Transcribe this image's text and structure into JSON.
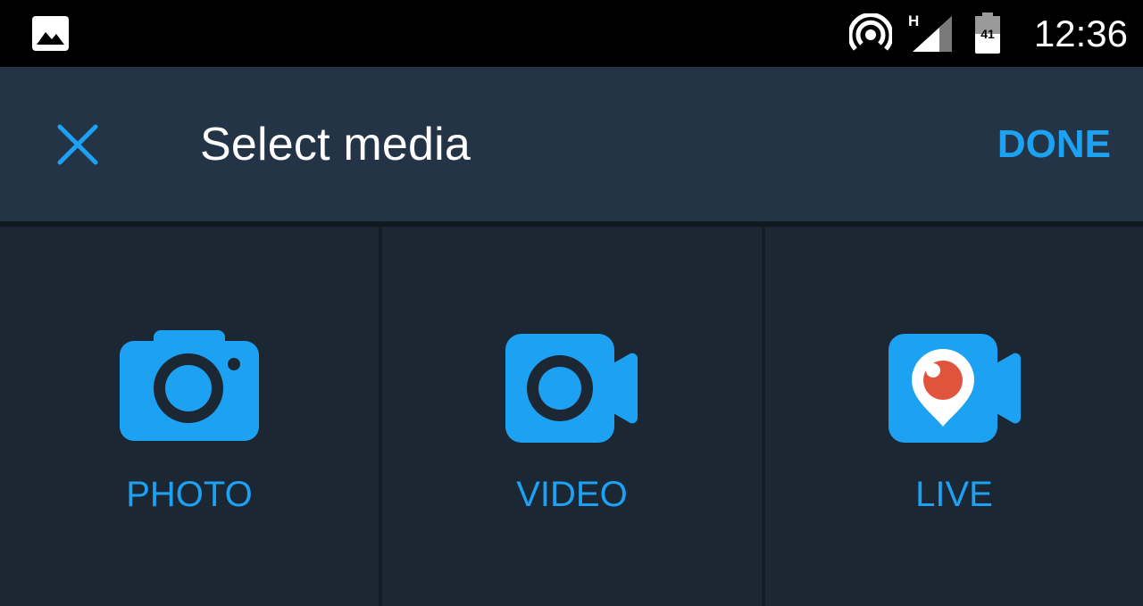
{
  "status_bar": {
    "time": "12:36",
    "network_type": "H",
    "battery_level": "41",
    "icons": [
      "gallery-icon",
      "hotspot-icon",
      "signal-icon",
      "battery-icon"
    ]
  },
  "app_bar": {
    "title": "Select media",
    "done_label": "DONE",
    "close_icon": "close-icon"
  },
  "options": [
    {
      "label": "PHOTO",
      "icon": "camera-icon"
    },
    {
      "label": "VIDEO",
      "icon": "video-camera-icon"
    },
    {
      "label": "LIVE",
      "icon": "periscope-live-icon"
    }
  ],
  "colors": {
    "accent": "#1da1f2",
    "app_bar_bg": "#243447",
    "tile_bg": "#1c2734",
    "live_dot": "#e0533d"
  }
}
